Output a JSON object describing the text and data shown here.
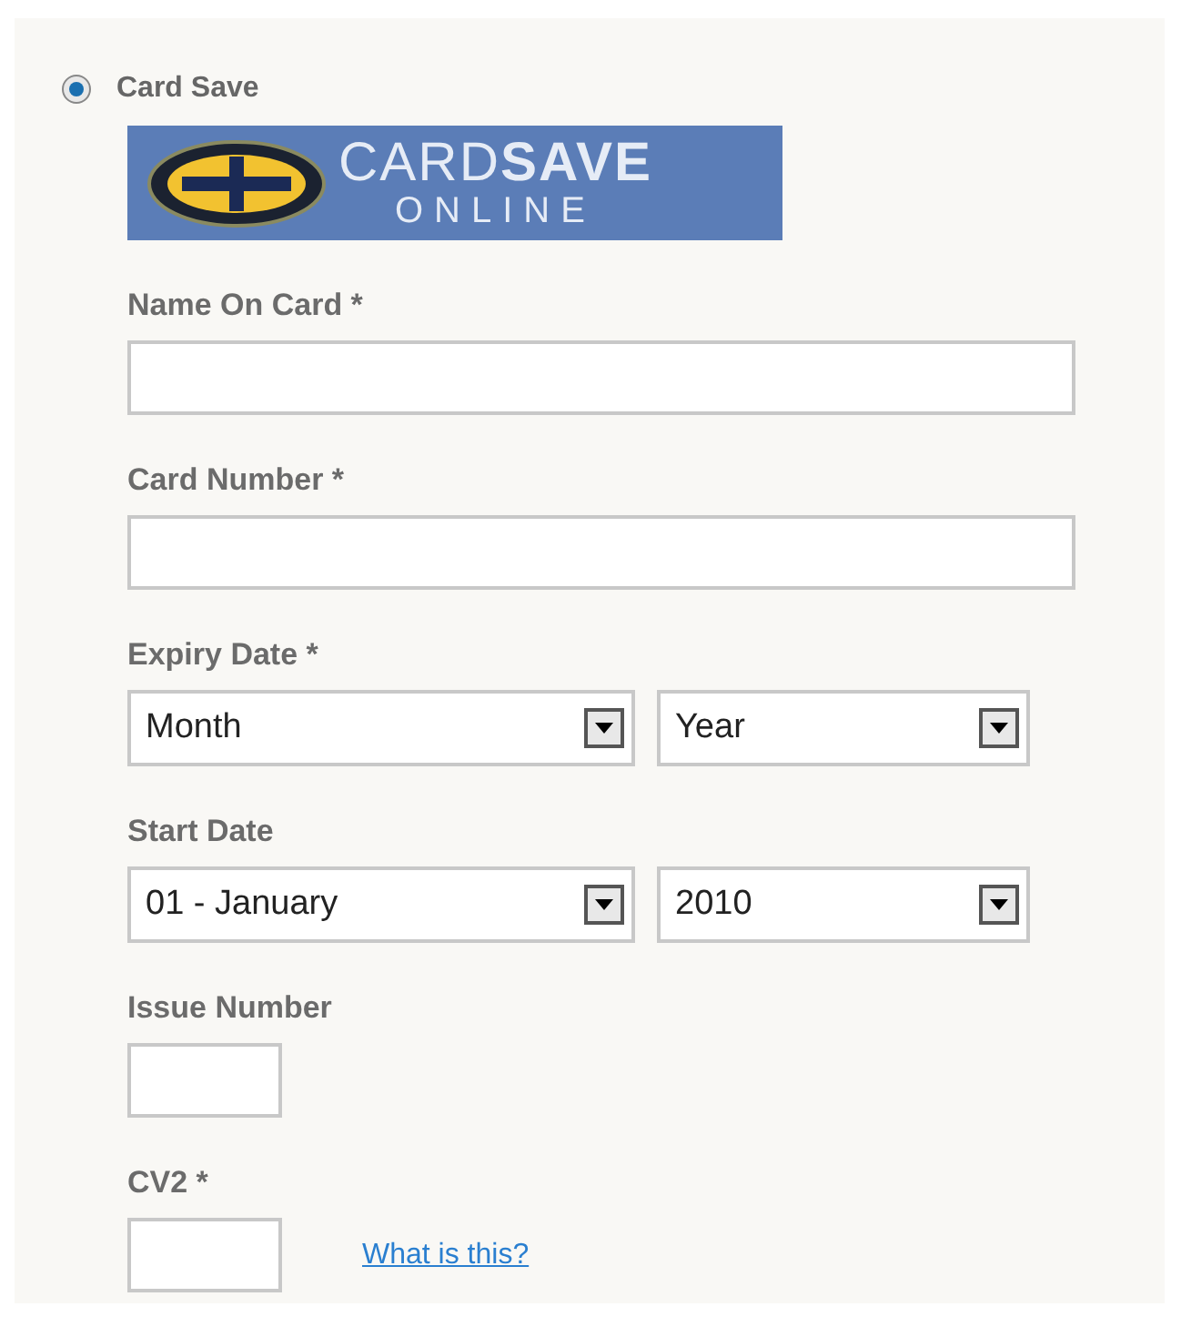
{
  "payment_option": {
    "label": "Card Save",
    "selected": true
  },
  "logo": {
    "word_light": "CARD",
    "word_bold": "SAVE",
    "subtitle": "ONLINE"
  },
  "fields": [
    {
      "kind": "text",
      "label": "Name On Card *"
    },
    {
      "kind": "text",
      "label": "Card Number *"
    },
    {
      "kind": "selects",
      "label": "Expiry Date *",
      "selects": [
        "Month",
        "Year"
      ]
    },
    {
      "kind": "selects",
      "label": "Start Date",
      "selects": [
        "01 - January",
        "2010"
      ]
    },
    {
      "kind": "short-text",
      "label": "Issue Number"
    },
    {
      "kind": "short-text",
      "label": "CV2 *",
      "link": "What is this?"
    }
  ]
}
